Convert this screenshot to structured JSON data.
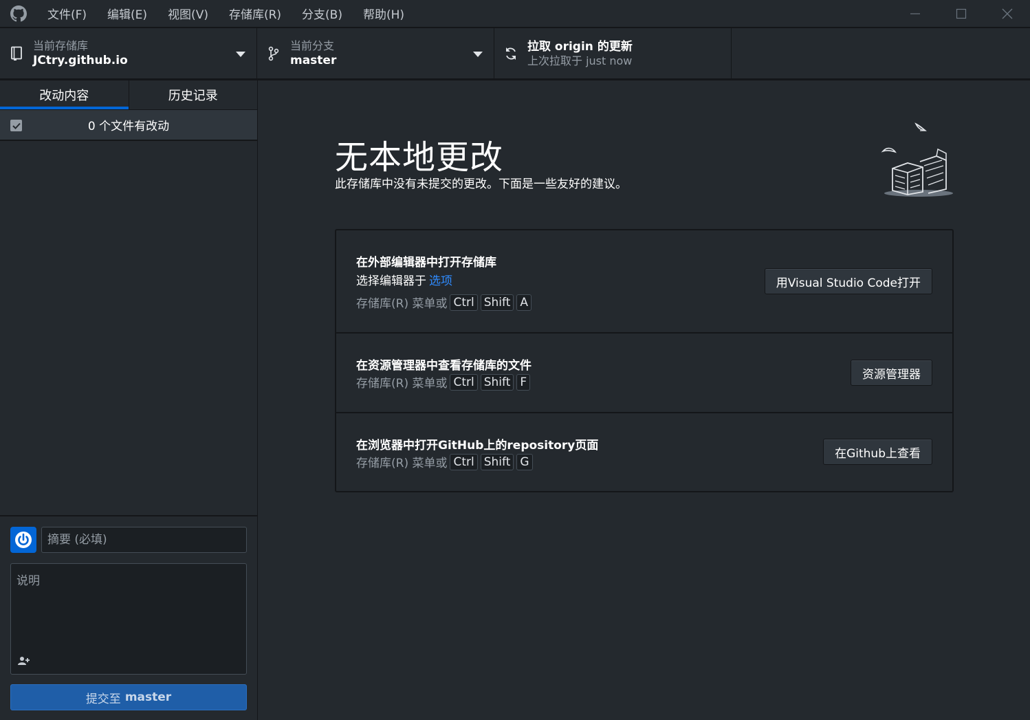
{
  "menu": [
    "文件(F)",
    "编辑(E)",
    "视图(V)",
    "存储库(R)",
    "分支(B)",
    "帮助(H)"
  ],
  "toolbar": {
    "repo_label": "当前存储库",
    "repo_value": "JCtry.github.io",
    "branch_label": "当前分支",
    "branch_value": "master",
    "fetch_title": "拉取 origin 的更新",
    "fetch_sub": "上次拉取于 just now"
  },
  "sidebar": {
    "tabs": [
      "改动内容",
      "历史记录"
    ],
    "changes_count": "0 个文件有改动",
    "summary_placeholder": "摘要 (必填)",
    "description_placeholder": "说明",
    "commit_prefix": "提交至",
    "commit_branch": "master"
  },
  "main": {
    "heading": "无本地更改",
    "subheading": "此存储库中没有未提交的更改。下面是一些友好的建议。",
    "suggestions": [
      {
        "title": "在外部编辑器中打开存储库",
        "subtitle": "选择编辑器于",
        "link": "选项",
        "shortcut_prefix": "存储库(R) 菜单或",
        "keys": [
          "Ctrl",
          "Shift",
          "A"
        ],
        "button": "用Visual Studio Code打开"
      },
      {
        "title": "在资源管理器中查看存储库的文件",
        "shortcut_prefix": "存储库(R) 菜单或",
        "keys": [
          "Ctrl",
          "Shift",
          "F"
        ],
        "button": "资源管理器"
      },
      {
        "title": "在浏览器中打开GitHub上的repository页面",
        "shortcut_prefix": "存储库(R) 菜单或",
        "keys": [
          "Ctrl",
          "Shift",
          "G"
        ],
        "button": "在Github上查看"
      }
    ]
  },
  "colors": {
    "background": "#24292e",
    "accent": "#0366d6",
    "commit_button": "#1f5ea8",
    "link": "#2f8bff"
  }
}
